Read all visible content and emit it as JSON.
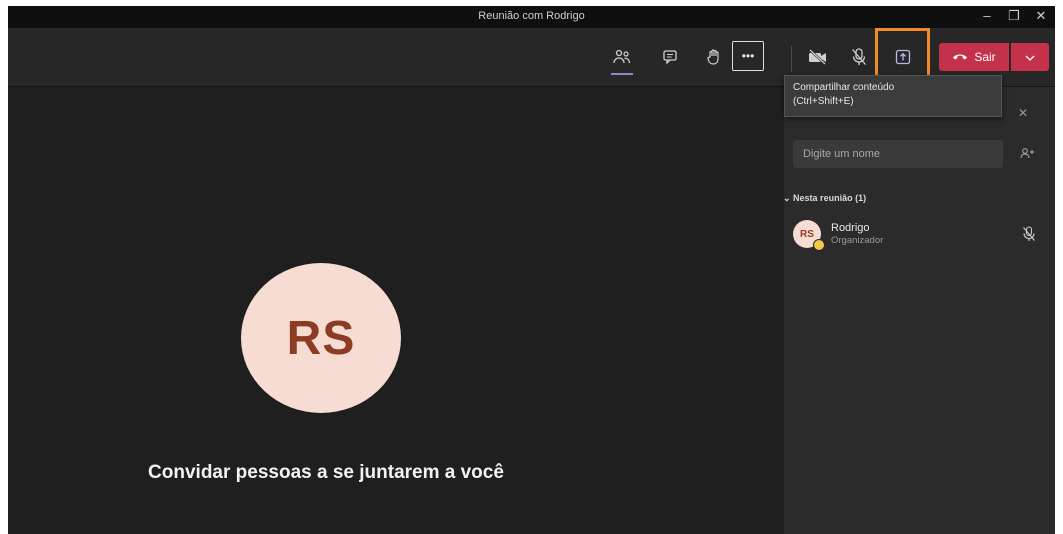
{
  "window": {
    "title": "Reunião com Rodrigo",
    "controls": {
      "minimize": "–",
      "maximize": "❐",
      "close": "✕"
    }
  },
  "toolbar": {
    "buttons": [
      {
        "icon": "participants-icon",
        "active": true
      },
      {
        "icon": "chat-icon"
      },
      {
        "icon": "raise-hand-icon"
      },
      {
        "icon": "more-actions-icon",
        "label": "•••"
      },
      {
        "icon": "camera-off-icon"
      },
      {
        "icon": "mic-off-icon"
      },
      {
        "icon": "share-screen-icon",
        "highlighted": true
      }
    ],
    "leave_label": "Sair"
  },
  "tooltip": {
    "text": "Compartilhar conteúdo",
    "shortcut": "(Ctrl+Shift+E)"
  },
  "stage": {
    "avatar_initials": "RS",
    "invite_text": "Convidar pessoas a se juntarem a você"
  },
  "panel": {
    "search_placeholder": "Digite um nome",
    "section_label": "Nesta reunião (1)",
    "participants": [
      {
        "initials": "RS",
        "name": "Rodrigo",
        "role": "Organizador",
        "muted": true
      }
    ]
  },
  "colors": {
    "leave": "#c4314b",
    "highlight": "#f28a2a",
    "accent": "#8b8cc7",
    "avatar_bg": "#f7dcd3",
    "avatar_fg": "#8b3c23"
  }
}
